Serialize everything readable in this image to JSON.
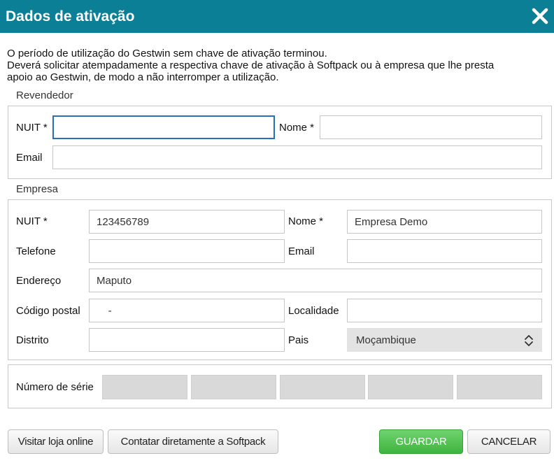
{
  "dialog": {
    "title": "Dados de ativação"
  },
  "notice": {
    "line1": "O período de utilização do Gestwin sem chave de ativação terminou.",
    "line2": "Deverá solicitar atempadamente a respectiva chave de ativação à Softpack ou à empresa que lhe presta",
    "line3": "apoio ao Gestwin, de modo a não interromper a utilização."
  },
  "revendedor": {
    "group_label": "Revendedor",
    "nuit_label": "NUIT *",
    "nuit_value": "",
    "nome_label": "Nome *",
    "nome_value": "",
    "email_label": "Email",
    "email_value": ""
  },
  "empresa": {
    "group_label": "Empresa",
    "nuit_label": "NUIT *",
    "nuit_value": "123456789",
    "nome_label": "Nome *",
    "nome_value": "Empresa Demo",
    "telefone_label": "Telefone",
    "telefone_value": "",
    "email_label": "Email",
    "email_value": "",
    "endereco_label": "Endereço",
    "endereco_value": "Maputo",
    "codigo_postal_label": "Código postal",
    "codigo_postal_value": "    -",
    "localidade_label": "Localidade",
    "localidade_value": "",
    "distrito_label": "Distrito",
    "distrito_value": "",
    "pais_label": "Pais",
    "pais_value": "Moçambique"
  },
  "serial": {
    "label": "Número de série",
    "segments": [
      "",
      "",
      "",
      "",
      ""
    ]
  },
  "buttons": {
    "visit_store": "Visitar loja online",
    "contact_softpack": "Contatar diretamente a Softpack",
    "save": "GUARDAR",
    "cancel": "CANCELAR"
  },
  "colors": {
    "titlebar": "#0b7f95",
    "save_button": "#4cbb4c",
    "focus_border": "#2a6fb6"
  },
  "icons": {
    "close": "close-icon",
    "select_arrows": "chevron-up-down-icon"
  }
}
